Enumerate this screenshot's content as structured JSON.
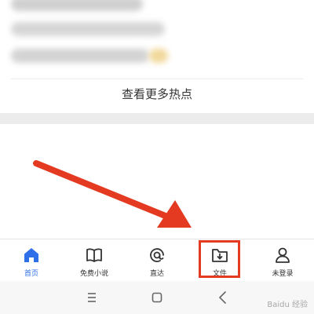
{
  "feed": {
    "more_hot_label": "查看更多热点"
  },
  "tabbar": {
    "items": [
      {
        "label": "首页",
        "icon": "home-icon",
        "active": true
      },
      {
        "label": "免费小说",
        "icon": "book-icon",
        "active": false
      },
      {
        "label": "直达",
        "icon": "direct-icon",
        "active": false
      },
      {
        "label": "文件",
        "icon": "file-download-icon",
        "active": false
      },
      {
        "label": "未登录",
        "icon": "user-icon",
        "active": false
      }
    ]
  },
  "system_nav": {
    "buttons": [
      "menu-icon",
      "home-square-icon",
      "back-icon"
    ]
  },
  "watermark": {
    "text": "Baidu 经验"
  },
  "colors": {
    "accent": "#2f6fe8",
    "annotation": "#e43a21"
  }
}
